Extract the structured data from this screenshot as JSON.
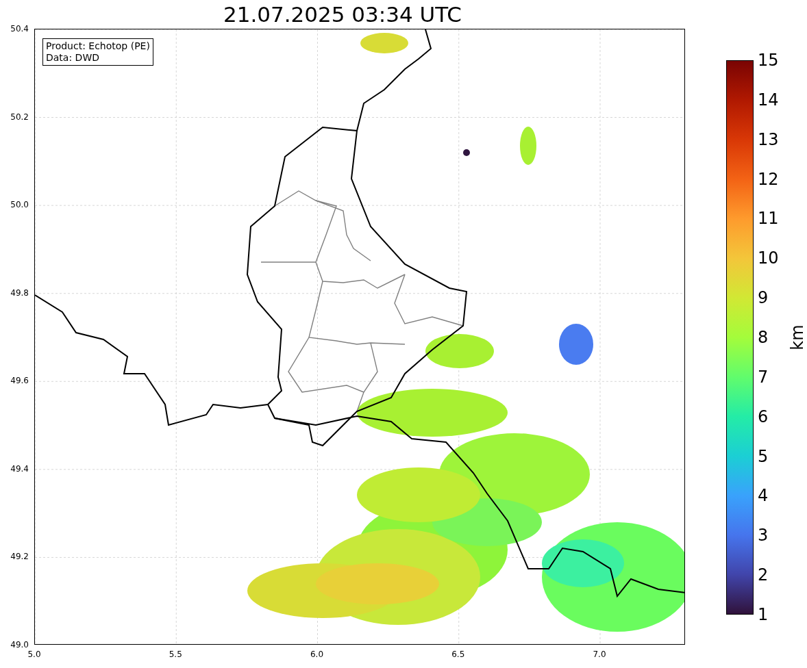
{
  "title": "21.07.2025 03:34 UTC",
  "legend": [
    "Product: Echotop (PE)",
    "Data: DWD"
  ],
  "x_ticks": [
    "5.0",
    "5.5",
    "6.0",
    "6.5",
    "7.0"
  ],
  "y_ticks": [
    "50.4",
    "50.2",
    "50.0",
    "49.8",
    "49.6",
    "49.4",
    "49.2",
    "49.0"
  ],
  "colorbar": {
    "label": "km",
    "ticks": [
      "15",
      "14",
      "13",
      "12",
      "11",
      "10",
      "9",
      "8",
      "7",
      "6",
      "5",
      "4",
      "3",
      "2",
      "1"
    ]
  }
}
